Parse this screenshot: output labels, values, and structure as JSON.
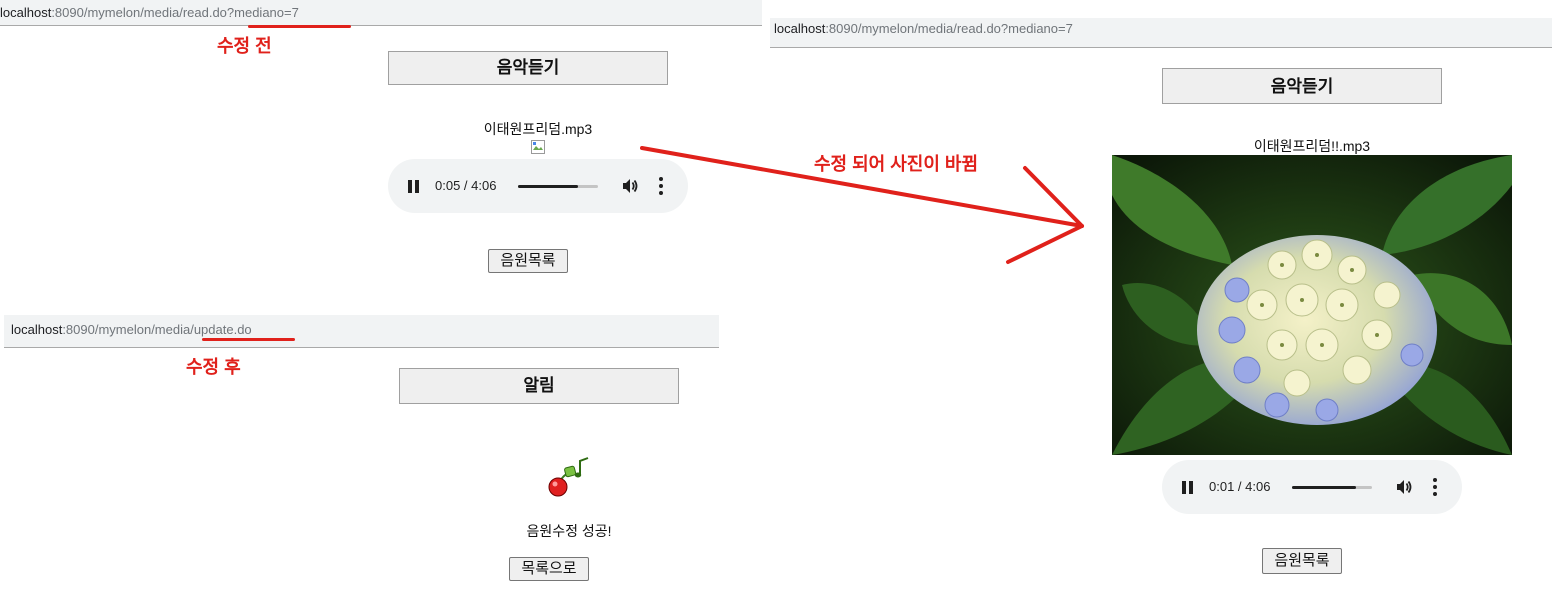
{
  "before_panel": {
    "url_host": "localhost",
    "url_rest": ":8090/mymelon/media/read.do?mediano=7",
    "note": "수정 전",
    "title": "음악듣기",
    "filename": "이태원프리덤.mp3",
    "player": {
      "time": "0:05 / 4:06",
      "progress": 0.75
    },
    "list_button": "음원목록"
  },
  "after_panel": {
    "url_host": "localhost",
    "url_rest": ":8090/mymelon/media/update.do",
    "note": "수정 후",
    "title": "알림",
    "message": "음원수정 성공!",
    "list_button": "목록으로"
  },
  "result_panel": {
    "url_host": "localhost",
    "url_rest": ":8090/mymelon/media/read.do?mediano=7",
    "title": "음악듣기",
    "filename": "이태원프리덤!!.mp3",
    "photo_icon": "hydrangea-photo",
    "player": {
      "time": "0:01 / 4:06",
      "progress": 0.8
    },
    "list_button": "음원목록"
  },
  "annotation": {
    "text": "수정 되어 사진이 바뀜",
    "color": "#e0211b"
  },
  "icons": {
    "broken_image": "broken-image-icon",
    "cherry_note": "cherry-music-icon",
    "pause": "pause-icon",
    "volume": "volume-icon",
    "more": "more-vert-icon"
  }
}
